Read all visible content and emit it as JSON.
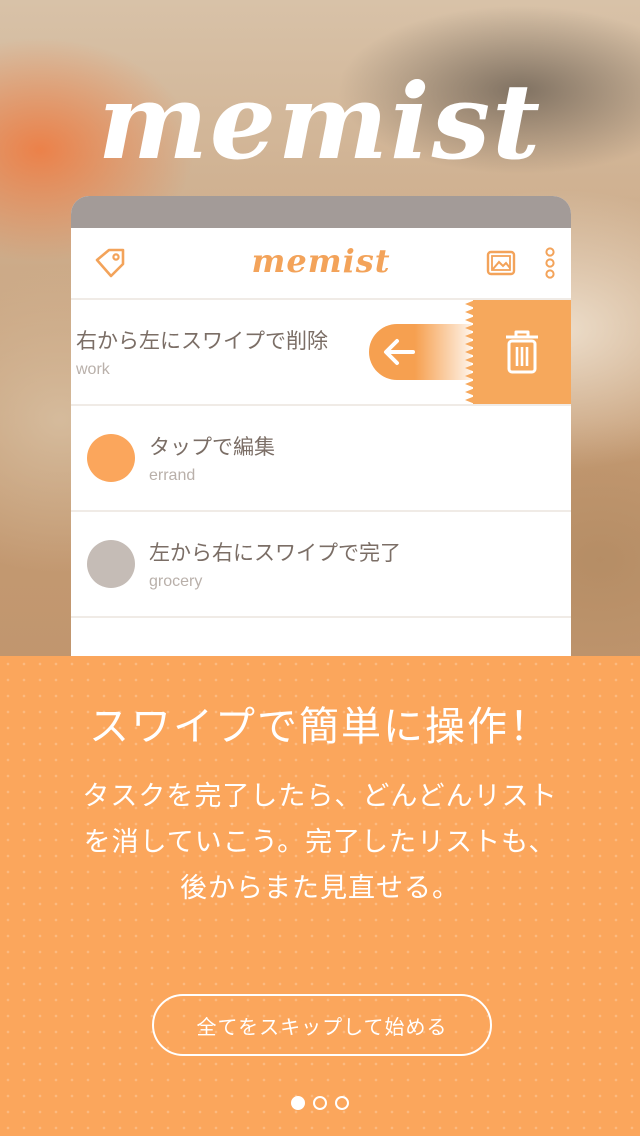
{
  "app": {
    "logo_text": "memist",
    "toolbar_logo_text": "memist",
    "accent_color": "#fba65c"
  },
  "phone": {
    "toolbar": {
      "icons": [
        "tag-icon",
        "image-icon",
        "more-vertical-icon"
      ]
    },
    "rows": [
      {
        "title": "右から左にスワイプで削除",
        "category": "work",
        "state": "swiping-delete"
      },
      {
        "title": "タップで編集",
        "category": "errand",
        "dot_color": "#fba65c"
      },
      {
        "title": "左から右にスワイプで完了",
        "category": "grocery",
        "dot_color": "#c5bcb6"
      }
    ],
    "action_icons": [
      "arrow-left-icon",
      "trash-icon"
    ]
  },
  "tutorial": {
    "headline": "スワイプで簡単に操作！",
    "body_lines": [
      "タスクを完了したら、どんどんリスト",
      "を消していこう。完了したリストも、",
      "後からまた見直せる。"
    ],
    "skip_button": "全てをスキップして始める",
    "page_count": 3,
    "current_page": 1
  }
}
